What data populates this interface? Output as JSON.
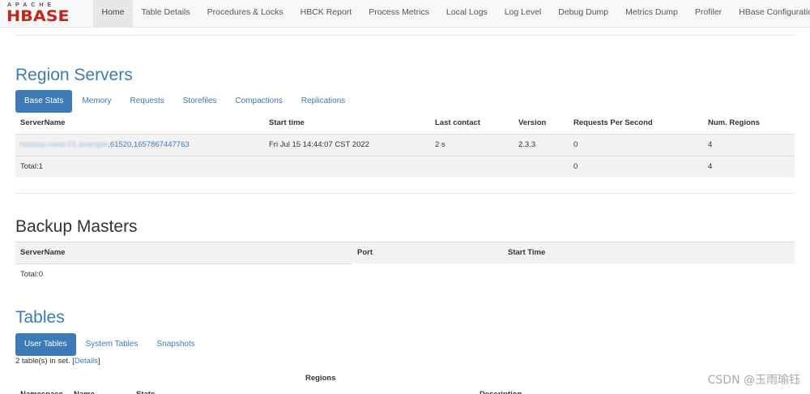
{
  "logo": {
    "apache": "APACHE",
    "hbase": "HBASE"
  },
  "nav": [
    "Home",
    "Table Details",
    "Procedures & Locks",
    "HBCK Report",
    "Process Metrics",
    "Local Logs",
    "Log Level",
    "Debug Dump",
    "Metrics Dump",
    "Profiler",
    "HBase Configuration"
  ],
  "region_servers": {
    "title": "Region Servers",
    "tabs": [
      "Base Stats",
      "Memory",
      "Requests",
      "Storefiles",
      "Compactions",
      "Replications"
    ],
    "headers": [
      "ServerName",
      "Start time",
      "Last contact",
      "Version",
      "Requests Per Second",
      "Num. Regions"
    ],
    "row": {
      "server_hidden": "hadoop-node-01.example",
      "server_visible": ",61520,1657867447763",
      "start_time": "Fri Jul 15 14:44:07 CST 2022",
      "last_contact": "2 s",
      "version": "2.3.3",
      "rps": "0",
      "regions": "4"
    },
    "total": {
      "label": "Total:1",
      "rps": "0",
      "regions": "4"
    }
  },
  "backup_masters": {
    "title": "Backup Masters",
    "headers": [
      "ServerName",
      "Port",
      "Start Time"
    ],
    "total": "Total:0"
  },
  "tables": {
    "title": "Tables",
    "tabs": [
      "User Tables",
      "System Tables",
      "Snapshots"
    ],
    "summary_pre": "2 table(s) in set. [",
    "details_link": "Details",
    "summary_post": "]",
    "regions_header": "Regions",
    "headers": [
      "Namespace",
      "Name",
      "State",
      "Description"
    ]
  },
  "watermark": "CSDN @玉雨瑜钰"
}
